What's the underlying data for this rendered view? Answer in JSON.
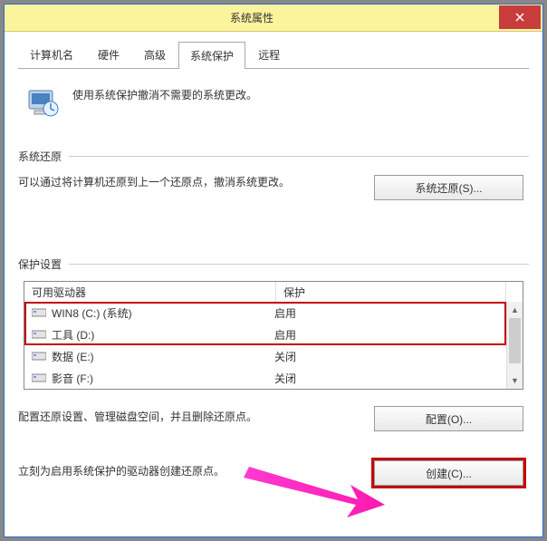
{
  "window": {
    "title": "系统属性"
  },
  "tabs": {
    "computer_name": "计算机名",
    "hardware": "硬件",
    "advanced": "高级",
    "system_protection": "系统保护",
    "remote": "远程"
  },
  "intro": {
    "text": "使用系统保护撤消不需要的系统更改。"
  },
  "restore": {
    "section": "系统还原",
    "desc": "可以通过将计算机还原到上一个还原点，撤消系统更改。",
    "button": "系统还原(S)..."
  },
  "protection": {
    "section": "保护设置",
    "header_drive": "可用驱动器",
    "header_protection": "保护",
    "drives": [
      {
        "name": "WIN8 (C:) (系统)",
        "protection": "启用"
      },
      {
        "name": "工具 (D:)",
        "protection": "启用"
      },
      {
        "name": "数据 (E:)",
        "protection": "关闭"
      },
      {
        "name": "影音 (F:)",
        "protection": "关闭"
      }
    ],
    "configure_desc": "配置还原设置、管理磁盘空间，并且删除还原点。",
    "configure_button": "配置(O)...",
    "create_desc": "立刻为启用系统保护的驱动器创建还原点。",
    "create_button": "创建(C)..."
  }
}
